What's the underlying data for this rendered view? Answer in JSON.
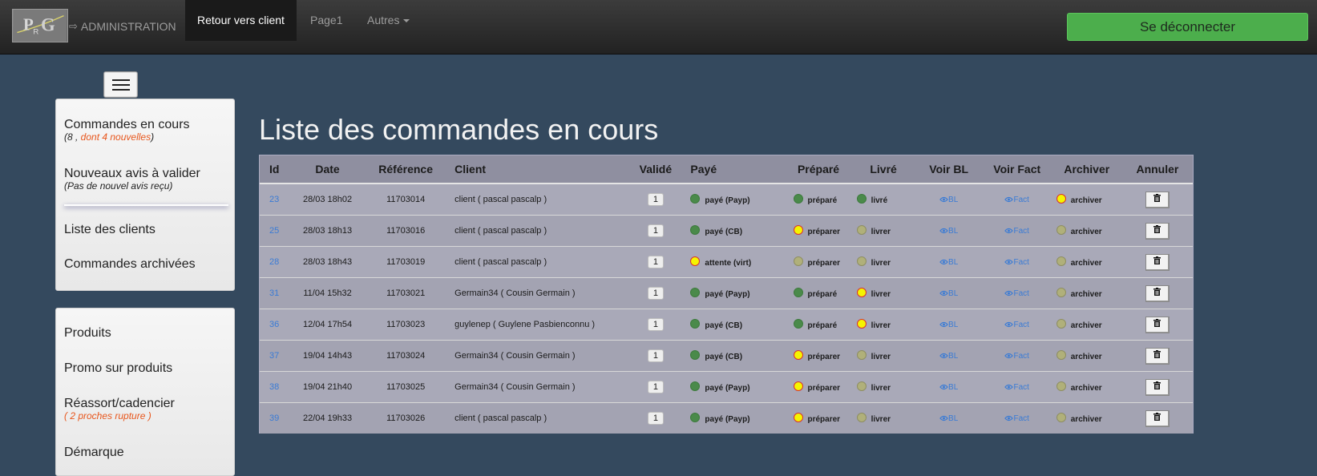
{
  "navbar": {
    "logo_text": "PRG",
    "brand_arrow": "⇨",
    "brand": "ADMINISTRATION",
    "items": [
      {
        "label": "Retour vers client",
        "active": true
      },
      {
        "label": "Page1",
        "active": false
      },
      {
        "label": "Autres",
        "active": false
      }
    ],
    "logout": "Se déconnecter"
  },
  "sidebar": {
    "panel1": [
      {
        "label": "Commandes en cours",
        "sub_prefix": "(8 , ",
        "sub_new": "dont 4 nouvelles",
        "sub_suffix": ")"
      },
      {
        "label": "Nouveaux avis à valider",
        "sub": "(Pas de nouvel avis reçu)"
      },
      {
        "label": "Liste des clients"
      },
      {
        "label": "Commandes archivées"
      }
    ],
    "panel2": [
      {
        "label": "Produits"
      },
      {
        "label": "Promo sur produits"
      },
      {
        "label": "Réassort/cadencier",
        "sub": "( 2 proches rupture )"
      },
      {
        "label": "Démarque"
      }
    ]
  },
  "main": {
    "title": "Liste des commandes en cours",
    "columns": [
      "Id",
      "Date",
      "Référence",
      "Client",
      "Validé",
      "Payé",
      "Préparé",
      "Livré",
      "Voir BL",
      "Voir Fact",
      "Archiver",
      "Annuler"
    ],
    "rows": [
      {
        "id": "23",
        "date": "28/03 18h02",
        "ref": "11703014",
        "client": "client ( pascal pascalp )",
        "valide": "1",
        "paye": "payé (Payp)",
        "paye_color": "green",
        "prep": "préparé",
        "prep_color": "green",
        "livre": "livré",
        "livre_color": "green",
        "bl": "BL",
        "fact": "Fact",
        "archiver": "archiver",
        "archiver_color": "yellow"
      },
      {
        "id": "25",
        "date": "28/03 18h13",
        "ref": "11703016",
        "client": "client ( pascal pascalp )",
        "valide": "1",
        "paye": "payé (CB)",
        "paye_color": "green",
        "prep": "préparer",
        "prep_color": "yellow",
        "livre": "livrer",
        "livre_color": "grey",
        "bl": "BL",
        "fact": "Fact",
        "archiver": "archiver",
        "archiver_color": "grey"
      },
      {
        "id": "28",
        "date": "28/03 18h43",
        "ref": "11703019",
        "client": "client ( pascal pascalp )",
        "valide": "1",
        "paye": "attente (virt)",
        "paye_color": "yellow",
        "prep": "préparer",
        "prep_color": "grey",
        "livre": "livrer",
        "livre_color": "grey",
        "bl": "BL",
        "fact": "Fact",
        "archiver": "archiver",
        "archiver_color": "grey"
      },
      {
        "id": "31",
        "date": "11/04 15h32",
        "ref": "11703021",
        "client": "Germain34 ( Cousin Germain )",
        "valide": "1",
        "paye": "payé (Payp)",
        "paye_color": "green",
        "prep": "préparé",
        "prep_color": "green",
        "livre": "livrer",
        "livre_color": "yellow",
        "bl": "BL",
        "fact": "Fact",
        "archiver": "archiver",
        "archiver_color": "grey"
      },
      {
        "id": "36",
        "date": "12/04 17h54",
        "ref": "11703023",
        "client": "guylenep ( Guylene Pasbienconnu )",
        "valide": "1",
        "paye": "payé (CB)",
        "paye_color": "green",
        "prep": "préparé",
        "prep_color": "green",
        "livre": "livrer",
        "livre_color": "yellow",
        "bl": "BL",
        "fact": "Fact",
        "archiver": "archiver",
        "archiver_color": "grey"
      },
      {
        "id": "37",
        "date": "19/04 14h43",
        "ref": "11703024",
        "client": "Germain34 ( Cousin Germain )",
        "valide": "1",
        "paye": "payé (CB)",
        "paye_color": "green",
        "prep": "préparer",
        "prep_color": "yellow",
        "livre": "livrer",
        "livre_color": "grey",
        "bl": "BL",
        "fact": "Fact",
        "archiver": "archiver",
        "archiver_color": "grey"
      },
      {
        "id": "38",
        "date": "19/04 21h40",
        "ref": "11703025",
        "client": "Germain34 ( Cousin Germain )",
        "valide": "1",
        "paye": "payé (Payp)",
        "paye_color": "green",
        "prep": "préparer",
        "prep_color": "yellow",
        "livre": "livrer",
        "livre_color": "grey",
        "bl": "BL",
        "fact": "Fact",
        "archiver": "archiver",
        "archiver_color": "grey"
      },
      {
        "id": "39",
        "date": "22/04 19h33",
        "ref": "11703026",
        "client": "client ( pascal pascalp )",
        "valide": "1",
        "paye": "payé (Payp)",
        "paye_color": "green",
        "prep": "préparer",
        "prep_color": "yellow",
        "livre": "livrer",
        "livre_color": "grey",
        "bl": "BL",
        "fact": "Fact",
        "archiver": "archiver",
        "archiver_color": "grey"
      }
    ]
  },
  "colors": {
    "background": "#34495e",
    "logout_button": "#4cae4c",
    "status_green": "#4a8a4a",
    "status_yellow": "#f5f500",
    "status_grey": "#b0b07a",
    "new_orders": "#e8561c",
    "link": "#3a7bd5"
  },
  "icons": {
    "eye": "eye-icon",
    "trash": "trash-icon",
    "menu": "hamburger-icon",
    "caret": "chevron-down-icon"
  }
}
